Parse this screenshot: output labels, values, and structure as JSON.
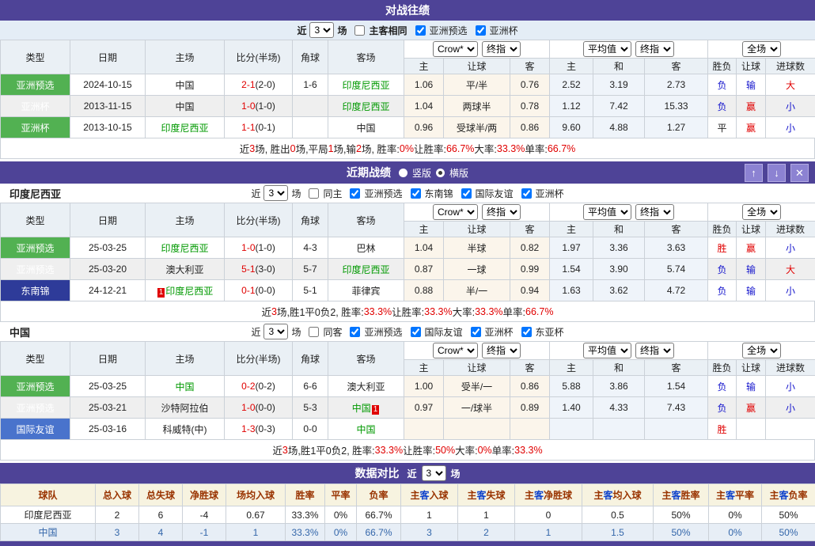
{
  "shared": {
    "near": "近",
    "games": "场",
    "count": "3",
    "cols": [
      "类型",
      "日期",
      "主场",
      "比分(半场)",
      "角球",
      "客场"
    ],
    "sub": [
      "主",
      "让球",
      "客",
      "主",
      "和",
      "客",
      "胜负",
      "让球",
      "进球数"
    ],
    "selects": {
      "crow": "Crow*",
      "final": "终指",
      "avg": "平均值",
      "full": "全场"
    }
  },
  "h2h": {
    "title": "对战往绩",
    "filter": {
      "same": "主客相同",
      "opt1": "亚洲预选",
      "opt2": "亚洲杯"
    },
    "rows": [
      {
        "type": "亚洲预选",
        "date": "2024-10-15",
        "home": "中国",
        "score": "2-1",
        "half": "(2-0)",
        "corner": "1-6",
        "away": "印度尼西亚",
        "o1": "1.06",
        "o2": "平/半",
        "o3": "0.76",
        "a1": "2.52",
        "a2": "3.19",
        "a3": "2.73",
        "r1": "负",
        "r2": "输",
        "r3": "大"
      },
      {
        "type": "亚洲杯",
        "date": "2013-11-15",
        "home": "中国",
        "score": "1-0",
        "half": "(1-0)",
        "corner": "",
        "away": "印度尼西亚",
        "o1": "1.04",
        "o2": "两球半",
        "o3": "0.78",
        "a1": "1.12",
        "a2": "7.42",
        "a3": "15.33",
        "r1": "负",
        "r2": "赢",
        "r3": "小"
      },
      {
        "type": "亚洲杯",
        "date": "2013-10-15",
        "home": "印度尼西亚",
        "score": "1-1",
        "half": "(0-1)",
        "corner": "",
        "away": "中国",
        "o1": "0.96",
        "o2": "受球半/两",
        "o3": "0.86",
        "a1": "9.60",
        "a2": "4.88",
        "a3": "1.27",
        "r1": "平",
        "r2": "赢",
        "r3": "小"
      }
    ],
    "summary": [
      "近 ",
      "3",
      " 场, 胜出 ",
      "0",
      " 场,平局 ",
      "1",
      " 场,输 ",
      "2",
      " 场, 胜率: ",
      "0%",
      " 让胜率: ",
      "66.7%",
      " 大率: ",
      "33.3%",
      " 单率: ",
      "66.7%"
    ]
  },
  "recent": {
    "title": "近期战绩",
    "vertical": "竖版",
    "horizontal": "横版",
    "up": "↑",
    "down": "↓",
    "close": "✕",
    "indo": {
      "team": "印度尼西亚",
      "same": "同主",
      "opts": [
        "亚洲预选",
        "东南锦",
        "国际友谊",
        "亚洲杯"
      ],
      "rows": [
        {
          "type": "亚洲预选",
          "date": "25-03-25",
          "home": "印度尼西亚",
          "score": "1-0",
          "half": "(1-0)",
          "corner": "4-3",
          "away": "巴林",
          "o1": "1.04",
          "o2": "半球",
          "o3": "0.82",
          "a1": "1.97",
          "a2": "3.36",
          "a3": "3.63",
          "r1": "胜",
          "r2": "赢",
          "r3": "小"
        },
        {
          "type": "亚洲预选",
          "date": "25-03-20",
          "home": "澳大利亚",
          "score": "5-1",
          "half": "(3-0)",
          "corner": "5-7",
          "away": "印度尼西亚",
          "o1": "0.87",
          "o2": "一球",
          "o3": "0.99",
          "a1": "1.54",
          "a2": "3.90",
          "a3": "5.74",
          "r1": "负",
          "r2": "输",
          "r3": "大"
        },
        {
          "type": "东南锦",
          "date": "24-12-21",
          "hb": "1",
          "home": "印度尼西亚",
          "score": "0-1",
          "half": "(0-0)",
          "corner": "5-1",
          "away": "菲律宾",
          "o1": "0.88",
          "o2": "半/一",
          "o3": "0.94",
          "a1": "1.63",
          "a2": "3.62",
          "a3": "4.72",
          "r1": "负",
          "r2": "输",
          "r3": "小"
        }
      ],
      "summary": [
        "近",
        "3",
        "场,胜1平0负2, 胜率:",
        "33.3%",
        " 让胜率:",
        "33.3%",
        " 大率:",
        "33.3%",
        " 单率:",
        "66.7%"
      ]
    },
    "china": {
      "team": "中国",
      "same": "同客",
      "opts": [
        "亚洲预选",
        "国际友谊",
        "亚洲杯",
        "东亚杯"
      ],
      "rows": [
        {
          "type": "亚洲预选",
          "date": "25-03-25",
          "home": "中国",
          "score": "0-2",
          "half": "(0-2)",
          "corner": "6-6",
          "away": "澳大利亚",
          "o1": "1.00",
          "o2": "受半/一",
          "o3": "0.86",
          "a1": "5.88",
          "a2": "3.86",
          "a3": "1.54",
          "r1": "负",
          "r2": "输",
          "r3": "小"
        },
        {
          "type": "亚洲预选",
          "date": "25-03-21",
          "home": "沙特阿拉伯",
          "score": "1-0",
          "half": "(0-0)",
          "corner": "5-3",
          "away": "中国",
          "ab": "1",
          "o1": "0.97",
          "o2": "一/球半",
          "o3": "0.89",
          "a1": "1.40",
          "a2": "4.33",
          "a3": "7.43",
          "r1": "负",
          "r2": "赢",
          "r3": "小"
        },
        {
          "type": "国际友谊",
          "date": "25-03-16",
          "home": "科威特(中)",
          "score": "1-3",
          "half": "(0-3)",
          "corner": "0-0",
          "away": "中国",
          "o1": "",
          "o2": "",
          "o3": "",
          "a1": "",
          "a2": "",
          "a3": "",
          "r1": "胜",
          "r2": "",
          "r3": ""
        }
      ],
      "summary": [
        "近",
        "3",
        "场,胜1平0负2, 胜率:",
        "33.3%",
        " 让胜率:",
        "50%",
        " 大率:",
        "0%",
        " 单率:",
        "33.3%"
      ]
    }
  },
  "compare": {
    "title": "数据对比",
    "headers": [
      "球队",
      "总入球",
      "总失球",
      "净胜球",
      "场均入球",
      "胜率",
      "平率",
      "负率"
    ],
    "hz": "主",
    "kz": "客",
    "hk_suffix": [
      "入球",
      "失球",
      "净胜球",
      "均入球",
      "胜率",
      "平率",
      "负率"
    ],
    "rows": [
      [
        "印度尼西亚",
        "2",
        "6",
        "-4",
        "0.67",
        "33.3%",
        "0%",
        "66.7%",
        "1",
        "1",
        "0",
        "0.5",
        "50%",
        "0%",
        "50%"
      ],
      [
        "中国",
        "3",
        "4",
        "-1",
        "1",
        "33.3%",
        "0%",
        "66.7%",
        "3",
        "2",
        "1",
        "1.5",
        "50%",
        "0%",
        "50%"
      ]
    ]
  }
}
